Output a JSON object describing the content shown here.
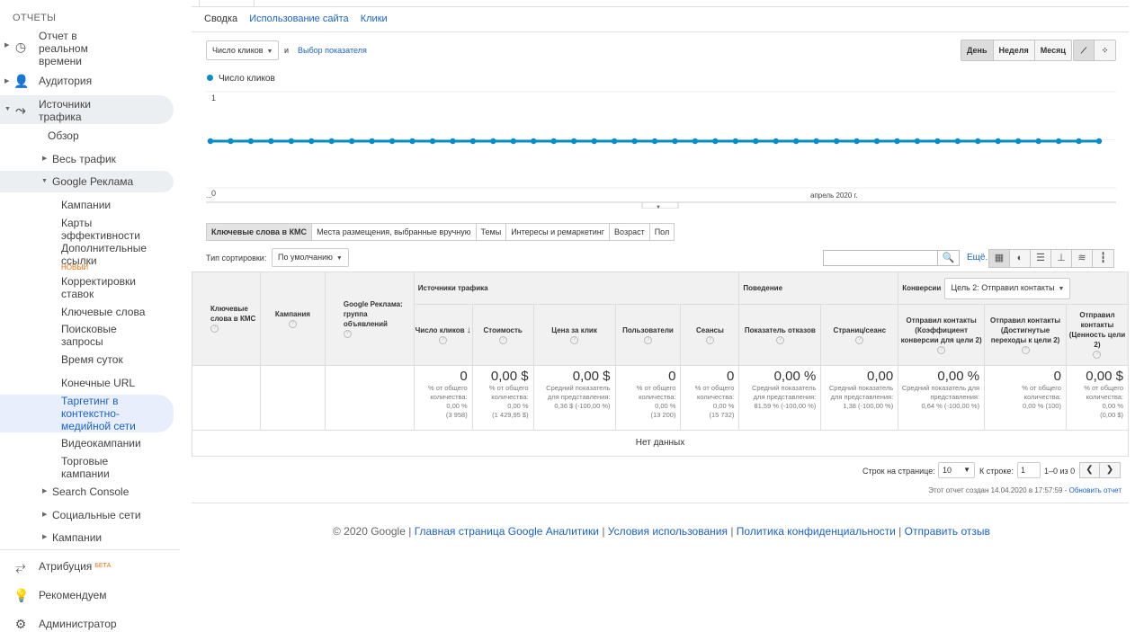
{
  "sidebar": {
    "section_title": "ОТЧЕТЫ",
    "items": [
      {
        "label": "Отчет в реальном времени",
        "icon": "clock-icon"
      },
      {
        "label": "Аудитория",
        "icon": "person-icon"
      },
      {
        "label": "Источники трафика",
        "icon": "acquisition-icon"
      },
      {
        "label": "Обзор"
      },
      {
        "label": "Весь трафик"
      },
      {
        "label": "Google Реклама"
      },
      {
        "label": "Кампании"
      },
      {
        "label": "Карты эффективности"
      },
      {
        "label": "Дополнительные ссылки",
        "badge": "НОВЫЙ"
      },
      {
        "label": "Корректировки ставок"
      },
      {
        "label": "Ключевые слова"
      },
      {
        "label": "Поисковые запросы"
      },
      {
        "label": "Время суток"
      },
      {
        "label": "Конечные URL"
      },
      {
        "label": "Таргетинг в контекстно-медийной сети"
      },
      {
        "label": "Видеокампании"
      },
      {
        "label": "Торговые кампании"
      },
      {
        "label": "Search Console"
      },
      {
        "label": "Социальные сети"
      },
      {
        "label": "Кампании"
      },
      {
        "label": "Атрибуция",
        "badge": "БЕТА",
        "icon": "attribution-icon"
      },
      {
        "label": "Рекомендуем",
        "icon": "lightbulb-icon"
      },
      {
        "label": "Администратор",
        "icon": "gear-icon"
      }
    ]
  },
  "subtabs": [
    "Сводка",
    "Использование сайта",
    "Клики"
  ],
  "metric": {
    "selected": "Число кликов",
    "and": "и",
    "choose": "Выбор показателя"
  },
  "period_buttons": [
    "День",
    "Неделя",
    "Месяц"
  ],
  "chart_data": {
    "type": "line",
    "series": [
      {
        "name": "Число кликов",
        "values": [
          0,
          0,
          0,
          0,
          0,
          0,
          0,
          0,
          0,
          0,
          0,
          0,
          0,
          0,
          0,
          0,
          0,
          0,
          0,
          0,
          0,
          0,
          0,
          0,
          0,
          0,
          0,
          0,
          0,
          0,
          0,
          0,
          0,
          0,
          0,
          0,
          0,
          0,
          0,
          0,
          0,
          0,
          0,
          0,
          0
        ]
      }
    ],
    "ylim": [
      0,
      1
    ],
    "yticks": [
      "1",
      "0"
    ],
    "xlabels": [
      "...",
      "апрель 2020 г."
    ],
    "color": "#058dc7"
  },
  "table_tabs": [
    "Ключевые слова в КМС",
    "Места размещения, выбранные вручную",
    "Темы",
    "Интересы и ремаркетинг",
    "Возраст",
    "Пол"
  ],
  "sort": {
    "label": "Тип сортировки:",
    "value": "По умолчанию"
  },
  "more_link": "Ещё...",
  "table": {
    "col_dims": [
      "Ключевые слова в КМС",
      "Кампания",
      "Google Реклама: группа объявлений"
    ],
    "groups": {
      "traffic": "Источники трафика",
      "behavior": "Поведение",
      "conversions": "Конверсии",
      "goal_select": "Цель 2: Отправил контакты"
    },
    "metrics": [
      {
        "h": "Число кликов",
        "v": "0",
        "s1": "% от общего количества:",
        "s2": "0,00 %",
        "s3": "(3 958)"
      },
      {
        "h": "Стоимость",
        "v": "0,00 $",
        "s1": "% от общего количества:",
        "s2": "0,00 %",
        "s3": "(1 429,95 $)"
      },
      {
        "h": "Цена за клик",
        "v": "0,00 $",
        "s1": "Средний показатель для представления:",
        "s2": "0,36 $ (-100,00 %)",
        "s3": ""
      },
      {
        "h": "Пользователи",
        "v": "0",
        "s1": "% от общего количества:",
        "s2": "0,00 %",
        "s3": "(13 200)"
      },
      {
        "h": "Сеансы",
        "v": "0",
        "s1": "% от общего количества:",
        "s2": "0,00 %",
        "s3": "(15 732)"
      },
      {
        "h": "Показатель отказов",
        "v": "0,00 %",
        "s1": "Средний показатель для представления:",
        "s2": "81,59 % (-100,00 %)",
        "s3": ""
      },
      {
        "h": "Страниц/сеанс",
        "v": "0,00",
        "s1": "Средний показатель для представления:",
        "s2": "1,38 (-100,00 %)",
        "s3": ""
      },
      {
        "h": "Отправил контакты (Коэффициент конверсии для цели 2)",
        "v": "0,00 %",
        "s1": "Средний показатель для представления:",
        "s2": "0,64 % (-100,00 %)",
        "s3": ""
      },
      {
        "h": "Отправил контакты (Достигнутые переходы к цели 2)",
        "v": "0",
        "s1": "% от общего количества:",
        "s2": "0,00 % (100)",
        "s3": ""
      },
      {
        "h": "Отправил контакты (Ценность цели 2)",
        "v": "0,00 $",
        "s1": "% от общего количества:",
        "s2": "0,00 %",
        "s3": "(0,00 $)"
      }
    ],
    "no_data": "Нет данных"
  },
  "pager": {
    "rows_label": "Строк на странице:",
    "rows_value": "10",
    "goto_label": "К строке:",
    "goto_value": "1",
    "range": "1–0 из 0"
  },
  "report_info": {
    "created": "Этот отчет создан 14.04.2020 в 17:57:59 -",
    "refresh": "Обновить отчет"
  },
  "footer": {
    "copyright": "© 2020 Google |",
    "l1": "Главная страница Google Аналитики",
    "l2": "Условия использования",
    "l3": "Политика конфиденциальности",
    "l4": "Отправить отзыв",
    "sep": "|"
  }
}
